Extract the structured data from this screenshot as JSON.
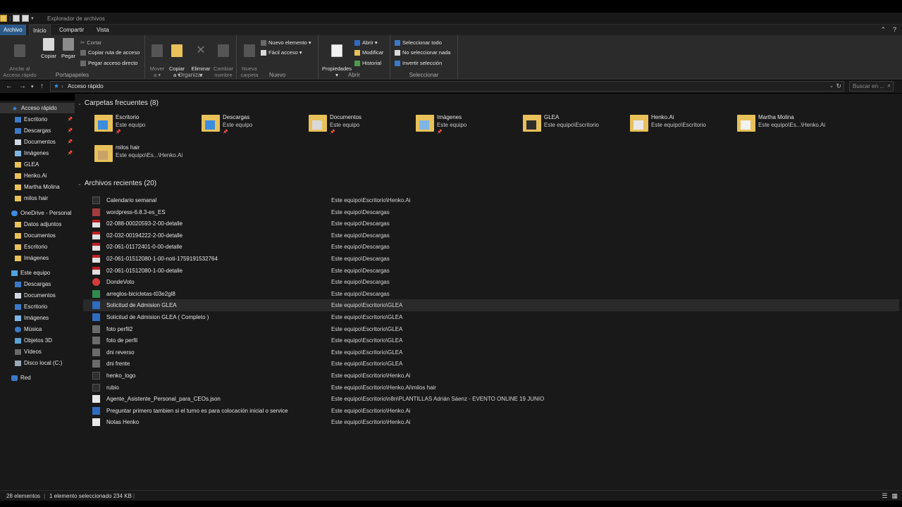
{
  "window": {
    "title": "Explorador de archivos"
  },
  "tabs": [
    {
      "label": "Archivo"
    },
    {
      "label": "Inicio"
    },
    {
      "label": "Compartir"
    },
    {
      "label": "Vista"
    }
  ],
  "ribbon": {
    "portapapeles": {
      "label": "Portapapeles",
      "anclar": "Anclar al\nAcceso rápido",
      "copiar": "Copiar",
      "pegar": "Pegar",
      "cortar": "Cortar",
      "copiar_ruta": "Copiar ruta de acceso",
      "pegar_directo": "Pegar acceso directo"
    },
    "organizar": {
      "label": "Organizar",
      "mover": "Mover\na ▾",
      "copiar": "Copiar\na ▾",
      "eliminar": "Eliminar\n▾",
      "cambiar_nombre": "Cambiar\nnombre"
    },
    "nuevo": {
      "label": "Nuevo",
      "nueva_carpeta": "Nueva\ncarpeta",
      "nuevo_elemento": "Nuevo elemento ▾",
      "facil_acceso": "Fácil acceso ▾"
    },
    "abrir": {
      "label": "Abrir",
      "propiedades": "Propiedades\n▾",
      "abrir": "Abrir ▾",
      "modificar": "Modificar",
      "historial": "Historial"
    },
    "seleccionar": {
      "label": "Seleccionar",
      "todo": "Seleccionar todo",
      "nada": "No seleccionar nada",
      "invertir": "Invertir selección"
    }
  },
  "address": {
    "path": "Acceso rápido",
    "search_placeholder": "Buscar en ..."
  },
  "sidebar": {
    "items": [
      {
        "label": "Acceso rápido",
        "icon": "star",
        "pinned": false
      },
      {
        "label": "Escritorio",
        "icon": "blue",
        "pinned": true
      },
      {
        "label": "Descargas",
        "icon": "blue",
        "pinned": true
      },
      {
        "label": "Documentos",
        "icon": "doc",
        "pinned": true
      },
      {
        "label": "Imágenes",
        "icon": "pic",
        "pinned": true
      },
      {
        "label": "GLEA",
        "icon": "folder",
        "pinned": false
      },
      {
        "label": "Henko.Ai",
        "icon": "folder",
        "pinned": false
      },
      {
        "label": "Martha Molina",
        "icon": "folder",
        "pinned": false
      },
      {
        "label": "milos hair",
        "icon": "folder",
        "pinned": false
      },
      {
        "label": "OneDrive - Personal",
        "icon": "cloud",
        "pinned": false
      },
      {
        "label": "Datos adjuntos",
        "icon": "folder",
        "pinned": false
      },
      {
        "label": "Documentos",
        "icon": "folder",
        "pinned": false
      },
      {
        "label": "Escritorio",
        "icon": "folder",
        "pinned": false
      },
      {
        "label": "Imágenes",
        "icon": "folder",
        "pinned": false
      },
      {
        "label": "Este equipo",
        "icon": "pc",
        "pinned": false
      },
      {
        "label": "Descargas",
        "icon": "blue",
        "pinned": false
      },
      {
        "label": "Documentos",
        "icon": "doc",
        "pinned": false
      },
      {
        "label": "Escritorio",
        "icon": "blue",
        "pinned": false
      },
      {
        "label": "Imágenes",
        "icon": "pic",
        "pinned": false
      },
      {
        "label": "Música",
        "icon": "music",
        "pinned": false
      },
      {
        "label": "Objetos 3D",
        "icon": "cube",
        "pinned": false
      },
      {
        "label": "Vídeos",
        "icon": "video",
        "pinned": false
      },
      {
        "label": "Disco local (C:)",
        "icon": "disk",
        "pinned": false
      },
      {
        "label": "Red",
        "icon": "net",
        "pinned": false
      }
    ]
  },
  "frequent": {
    "header": "Carpetas frecuentes (8)",
    "folders": [
      {
        "name": "Escritorio",
        "path": "Este equipo",
        "pinned": true,
        "accent": "#3b8de0"
      },
      {
        "name": "Descargas",
        "path": "Este equipo",
        "pinned": true,
        "accent": "#3b8de0"
      },
      {
        "name": "Documentos",
        "path": "Este equipo",
        "pinned": true,
        "accent": "#d9d9d9"
      },
      {
        "name": "Imágenes",
        "path": "Este equipo",
        "pinned": true,
        "accent": "#7fb6e6"
      },
      {
        "name": "GLEA",
        "path": "Este equipo\\Escritorio",
        "pinned": false,
        "accent": "#2e2e2e"
      },
      {
        "name": "Henko.Ai",
        "path": "Este equipo\\Escritorio",
        "pinned": false,
        "accent": "#e8e8e8"
      },
      {
        "name": "Martha Molina",
        "path": "Este equipo\\Es...\\Henko.Ai",
        "pinned": false,
        "accent": "#f2f2f2"
      },
      {
        "name": "milos hair",
        "path": "Este equipo\\Es...\\Henko.Ai",
        "pinned": false,
        "accent": "#c9a36a"
      }
    ]
  },
  "recent": {
    "header": "Archivos recientes (20)",
    "files": [
      {
        "name": "Calendario semanal",
        "location": "Este equipo\\Escritorio\\Henko.Ai",
        "icon": "dark"
      },
      {
        "name": "wordpress-6.8.3-es_ES",
        "location": "Este equipo\\Descargas",
        "icon": "zip"
      },
      {
        "name": "02-088-00020593-2-00-detalle",
        "location": "Este equipo\\Descargas",
        "icon": "pdf"
      },
      {
        "name": "02-032-00194222-2-00-detalle",
        "location": "Este equipo\\Descargas",
        "icon": "pdf"
      },
      {
        "name": "02-061-01172401-0-00-detalle",
        "location": "Este equipo\\Descargas",
        "icon": "pdf"
      },
      {
        "name": "02-061-01512080-1-00-noti-1759191532764",
        "location": "Este equipo\\Descargas",
        "icon": "pdf"
      },
      {
        "name": "02-061-01512080-1-00-detalle",
        "location": "Este equipo\\Descargas",
        "icon": "pdf"
      },
      {
        "name": "DondeVoto",
        "location": "Este equipo\\Descargas",
        "icon": "chrome"
      },
      {
        "name": "arreglos-bicicletas-t03e2gl8",
        "location": "Este equipo\\Descargas",
        "icon": "excel"
      },
      {
        "name": "Solicitud de Admision GLEA",
        "location": "Este equipo\\Escritorio\\GLEA",
        "icon": "word",
        "hover": true
      },
      {
        "name": "Solicitud de Admision GLEA ( Completo )",
        "location": "Este equipo\\Escritorio\\GLEA",
        "icon": "word"
      },
      {
        "name": "foto perfil2",
        "location": "Este equipo\\Escritorio\\GLEA",
        "icon": "img"
      },
      {
        "name": "foto de perfil",
        "location": "Este equipo\\Escritorio\\GLEA",
        "icon": "img"
      },
      {
        "name": "dni reverso",
        "location": "Este equipo\\Escritorio\\GLEA",
        "icon": "img"
      },
      {
        "name": "dni frente",
        "location": "Este equipo\\Escritorio\\GLEA",
        "icon": "img"
      },
      {
        "name": "henko_logo",
        "location": "Este equipo\\Escritorio\\Henko.Ai",
        "icon": "dark"
      },
      {
        "name": "rubio",
        "location": "Este equipo\\Escritorio\\Henko.Ai\\milos hair",
        "icon": "dark"
      },
      {
        "name": "Agente_Asistente_Personal_para_CEOs.json",
        "location": "Este equipo\\Escritorio\\n8n\\PLANTILLAS Adrián Sáenz - EVENTO ONLINE 19 JUNIO",
        "icon": "txt"
      },
      {
        "name": "Preguntar primero tambien si el turno es para colocación inicial o service",
        "location": "Este equipo\\Escritorio\\Henko.Ai",
        "icon": "word"
      },
      {
        "name": "Notas Henko",
        "location": "Este equipo\\Escritorio\\Henko.Ai",
        "icon": "txt"
      }
    ]
  },
  "status": {
    "count": "28 elementos",
    "selection": "1 elemento seleccionado  234 KB"
  }
}
